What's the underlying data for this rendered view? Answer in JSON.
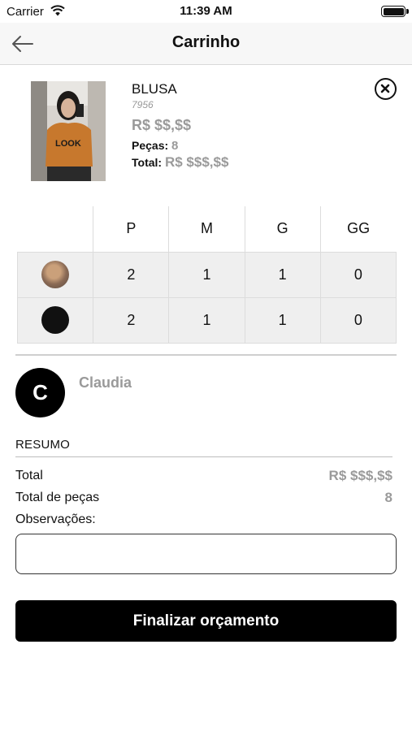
{
  "status_bar": {
    "carrier": "Carrier",
    "time": "11:39 AM"
  },
  "nav": {
    "title": "Carrinho",
    "back_icon": "arrow-left-icon"
  },
  "product": {
    "name": "BLUSA",
    "code": "7956",
    "price": "R$ $$,$$",
    "pecas_label": "Peças:",
    "pecas_value": "8",
    "total_label": "Total:",
    "total_value": "R$ $$$,$$",
    "remove_icon": "close-circle-icon"
  },
  "size_table": {
    "headers": [
      "P",
      "M",
      "G",
      "GG"
    ],
    "rows": [
      {
        "color": "orange",
        "values": [
          "2",
          "1",
          "1",
          "0"
        ]
      },
      {
        "color": "black",
        "values": [
          "2",
          "1",
          "1",
          "0"
        ]
      }
    ]
  },
  "client": {
    "initial": "C",
    "name": "Claudia"
  },
  "summary": {
    "title": "RESUMO",
    "total_label": "Total",
    "total_value": "R$ $$$,$$",
    "pecas_label": "Total de peças",
    "pecas_value": "8",
    "obs_label": "Observações:",
    "obs_value": ""
  },
  "actions": {
    "finish_label": "Finalizar orçamento"
  },
  "colors": {
    "primary": "#000000",
    "muted_text": "#9a9a9a",
    "table_cell_bg": "#efefef",
    "nav_bg": "#f7f7f7"
  }
}
